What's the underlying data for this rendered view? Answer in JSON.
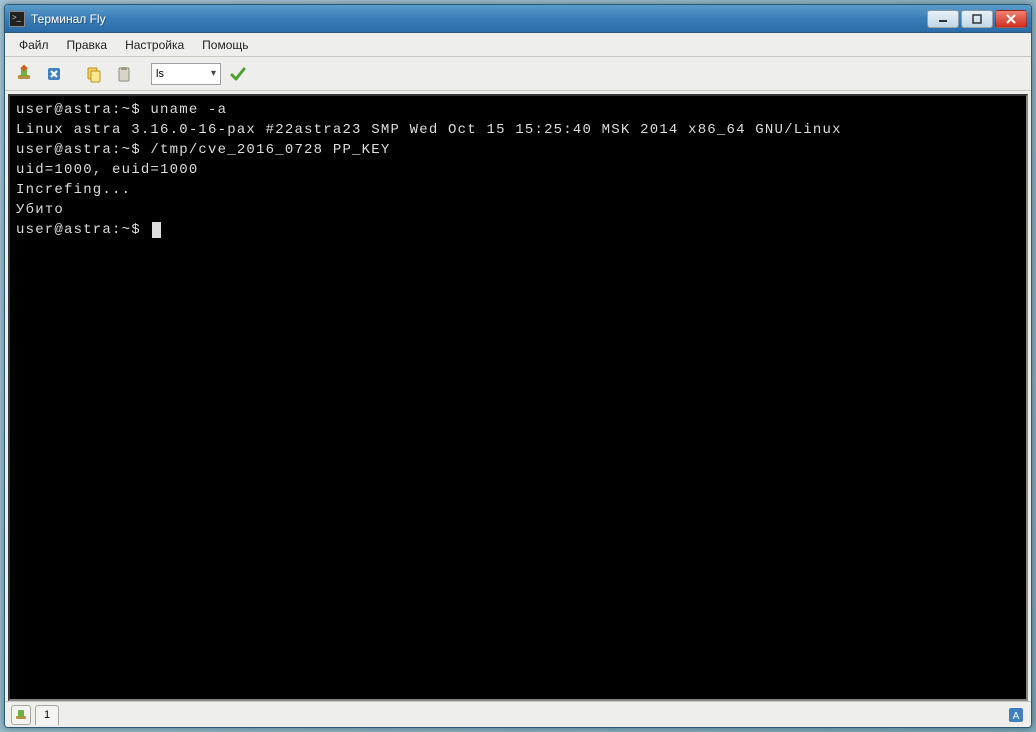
{
  "window": {
    "title": "Терминал Fly"
  },
  "menu": {
    "file": "Файл",
    "edit": "Правка",
    "settings": "Настройка",
    "help": "Помощь"
  },
  "toolbar": {
    "combo_value": "ls"
  },
  "terminal": {
    "lines": [
      "user@astra:~$ uname -a",
      "Linux astra 3.16.0-16-pax #22astra23 SMP Wed Oct 15 15:25:40 MSK 2014 x86_64 GNU/Linux",
      "user@astra:~$ /tmp/cve_2016_0728 PP_KEY",
      "uid=1000, euid=1000",
      "Increfing...",
      "Убито",
      "user@astra:~$ "
    ]
  },
  "tabs": {
    "active_label": "1"
  }
}
